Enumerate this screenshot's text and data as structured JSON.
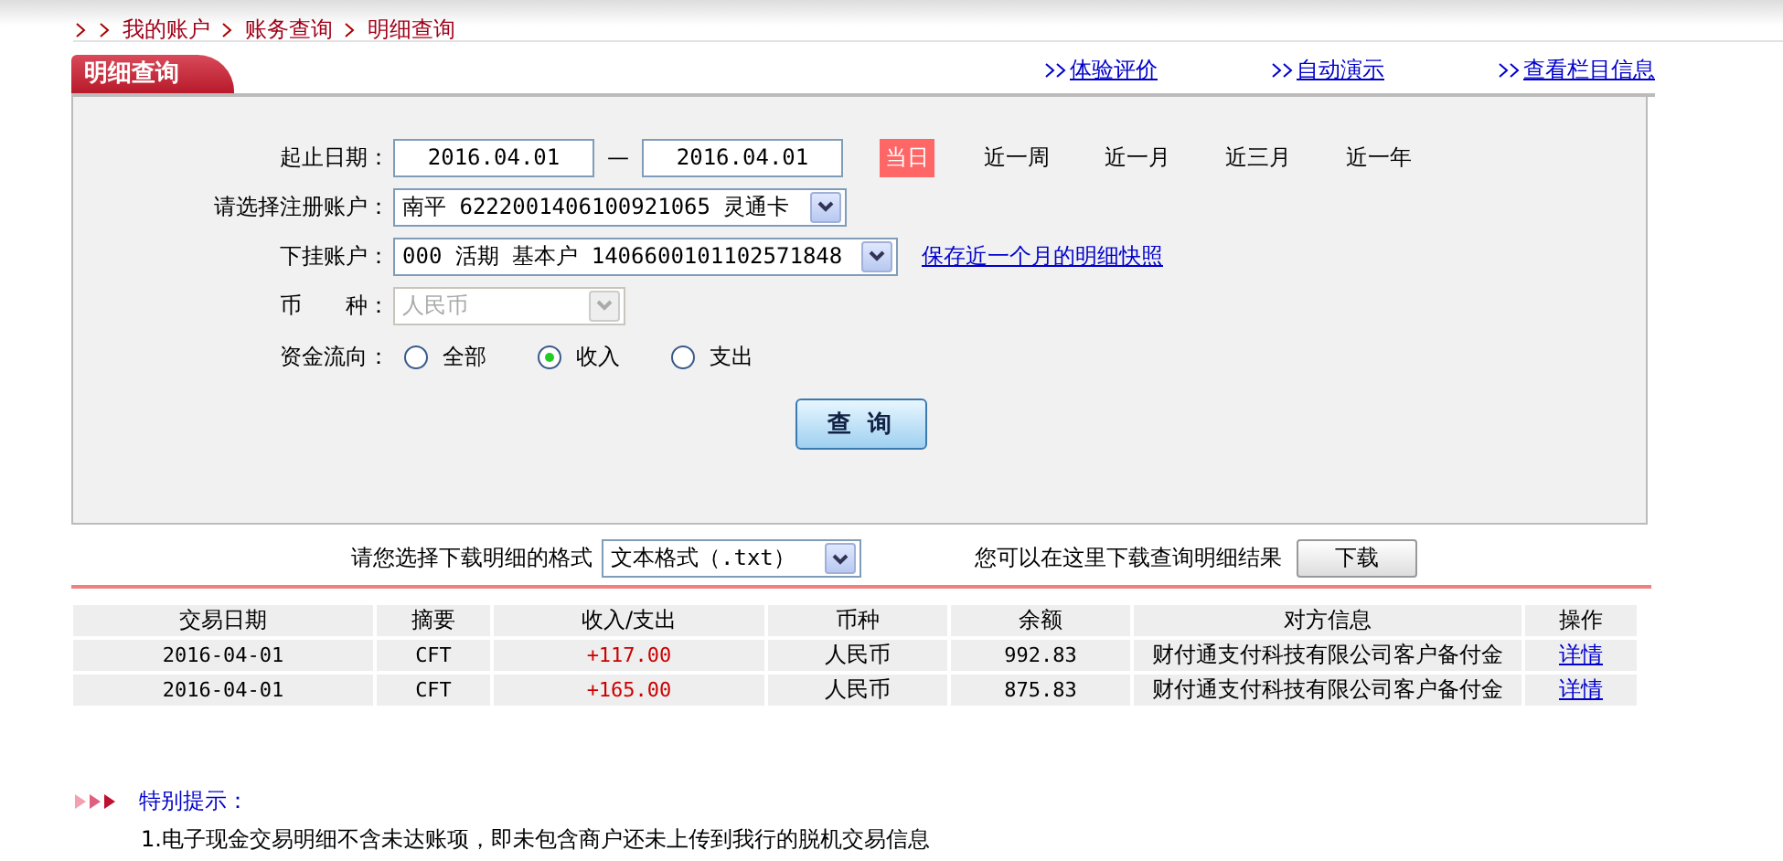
{
  "breadcrumb": [
    {
      "label": "我的账户"
    },
    {
      "label": "账务查询"
    },
    {
      "label": "明细查询"
    }
  ],
  "tab": {
    "label": "明细查询"
  },
  "links": [
    "体验评价",
    "自动演示",
    "查看栏目信息"
  ],
  "form": {
    "date_label": "起止日期：",
    "start_date": "2016.04.01",
    "separator": "—",
    "end_date": "2016.04.01",
    "ranges": [
      {
        "label": "当日",
        "selected": true
      },
      {
        "label": "近一周",
        "selected": false
      },
      {
        "label": "近一月",
        "selected": false
      },
      {
        "label": "近三月",
        "selected": false
      },
      {
        "label": "近一年",
        "selected": false
      }
    ],
    "account_label": "请选择注册账户：",
    "account": "南平 6222001406100921065 灵通卡",
    "sub_label": "下挂账户：",
    "sub_account": "000 活期 基本户 1406600101102571848",
    "snapshot_link": "保存近一个月的明细快照",
    "currency_label": "币　　种：",
    "currency": "人民币",
    "currency_disabled": true,
    "flow_label": "资金流向：",
    "flow": [
      {
        "label": "全部",
        "selected": false
      },
      {
        "label": "收入",
        "selected": true
      },
      {
        "label": "支出",
        "selected": false
      }
    ],
    "query_button": "查 询"
  },
  "download": {
    "label": "请您选择下载明细的格式",
    "format": "文本格式（.txt）",
    "hint": "您可以在这里下载查询明细结果",
    "button": "下载"
  },
  "table": {
    "columns": [
      "交易日期",
      "摘要",
      "收入/支出",
      "币种",
      "余额",
      "对方信息",
      "操作"
    ],
    "rows": [
      {
        "cells": [
          "2016-04-01",
          "CFT",
          "+117.00",
          "人民币",
          "992.83",
          "财付通支付科技有限公司客户备付金"
        ],
        "action": "详情"
      },
      {
        "cells": [
          "2016-04-01",
          "CFT",
          "+165.00",
          "人民币",
          "875.83",
          "财付通支付科技有限公司客户备付金"
        ],
        "action": "详情"
      }
    ]
  },
  "notice": {
    "title": "特别提示：",
    "items": [
      "1.电子现金交易明细不含未达账项，即未包含商户还未上传到我行的脱机交易信息"
    ]
  }
}
